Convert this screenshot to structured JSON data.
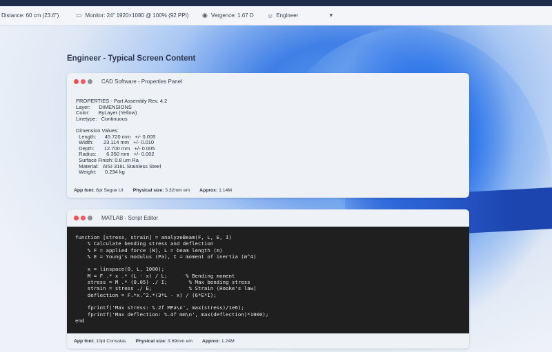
{
  "toolbar": {
    "distance": "Distance: 60 cm (23.6\")",
    "monitor": "Monitor: 24\" 1920×1080 @ 100% (92 PPI)",
    "vergence": "Vergence: 1.67 D",
    "profile": "Engineer"
  },
  "page_title": "Engineer - Typical Screen Content",
  "cad": {
    "title": "CAD Software - Properties Panel",
    "lines": [
      "PROPERTIES - Part Assembly Rev. 4.2",
      "Layer:      DIMENSIONS",
      "Color:      ByLayer (Yellow)",
      "Linetype:   Continuous",
      "",
      "Dimension Values:",
      "  Length:      45.720 mm   +/- 0.005",
      "  Width:       23.114 mm   +/- 0.010",
      "  Depth:       12.700 mm   +/- 0.005",
      "  Radius:       6.350 mm   +/- 0.002",
      "  Surface Finish: 0.8 um Ra",
      "  Material:   AISI 316L Stainless Steel",
      "  Weight:      0.234 kg"
    ],
    "footer": {
      "font_label": "App font:",
      "font_value": "8pt Segoe UI",
      "size_label": "Physical size:",
      "size_value": "3.32mm em",
      "approx_label": "Approx:",
      "approx_value": "1.14M"
    }
  },
  "matlab": {
    "title": "MATLAB - Script Editor",
    "code": "function [stress, strain] = analyzeBeam(F, L, E, I)\n    % Calculate bending stress and deflection\n    % F = applied force (N), L = beam length (m)\n    % E = Young's modulus (Pa), I = moment of inertia (m^4)\n\n    x = linspace(0, L, 1000);\n    M = F .* x .* (L - x) / L;      % Bending moment\n    stress = M .* (0.05) ./ I;       % Max bending stress\n    strain = stress ./ E;            % Strain (Hooke's law)\n    deflection = F.*x.^2.*(3*L - x) / (6*E*I);\n\n    fprintf('Max stress: %.2f MPa\\n', max(stress)/1e6);\n    fprintf('Max deflection: %.4f mm\\n', max(deflection)*1000);\nend",
    "footer": {
      "font_label": "App font:",
      "font_value": "10pt Consolas",
      "size_label": "Physical size:",
      "size_value": "3.69mm em",
      "approx_label": "Approx:",
      "approx_value": "1.24M"
    }
  },
  "icons": {
    "monitor": "monitor-icon",
    "vergence": "eye-icon",
    "profile": "person-icon",
    "dropdown": "chevron-down-icon"
  }
}
